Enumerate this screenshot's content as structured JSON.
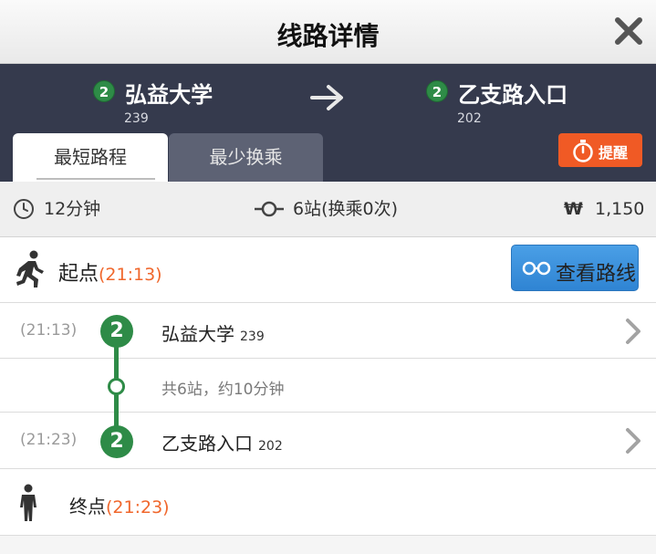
{
  "header": {
    "title": "线路详情"
  },
  "route": {
    "from": {
      "line": "2",
      "name": "弘益大学",
      "code": "239"
    },
    "to": {
      "line": "2",
      "name": "乙支路入口",
      "code": "202"
    },
    "tabs": [
      {
        "label": "最短路程",
        "active": true
      },
      {
        "label": "最少换乘",
        "active": false
      }
    ],
    "remind_label": "提醒"
  },
  "summary": {
    "duration": "12分钟",
    "stops": "6站(换乘0次)",
    "currency_symbol": "₩",
    "fare": "1,150"
  },
  "start": {
    "label": "起点",
    "time": "(21:13)",
    "view_route_label": "查看路线"
  },
  "stops": [
    {
      "time": "(21:13)",
      "line": "2",
      "name": "弘益大学",
      "code": "239"
    },
    {
      "time": "(21:23)",
      "line": "2",
      "name": "乙支路入口",
      "code": "202"
    }
  ],
  "segment_info": "共6站，约10分钟",
  "end": {
    "label": "终点",
    "time": "(21:23)"
  },
  "colors": {
    "line2": "#2e8b47",
    "header_dark": "#353a4d",
    "accent_orange": "#f05a25",
    "button_blue": "#2f84d3"
  },
  "icons": [
    "close-icon",
    "arrow-right-icon",
    "timer-icon",
    "clock-icon",
    "stops-icon",
    "walking-person-icon",
    "route-glasses-icon",
    "chevron-right-icon",
    "standing-person-icon"
  ]
}
